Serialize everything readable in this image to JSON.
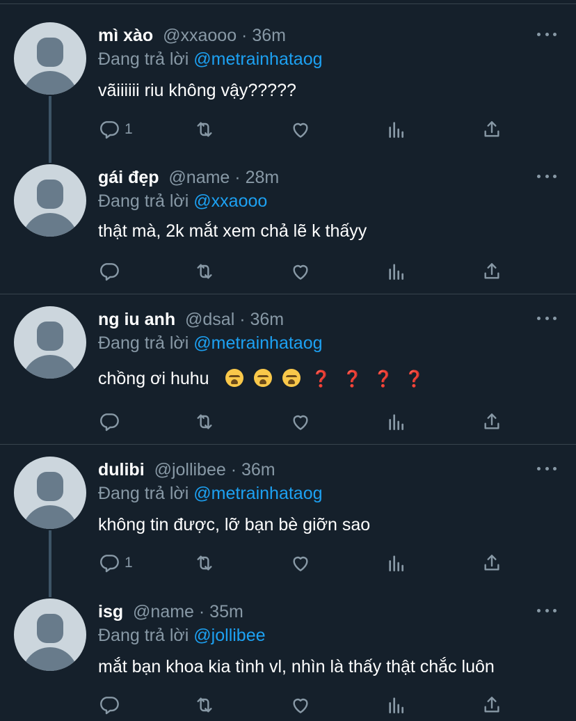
{
  "icons": {
    "reply": "reply-icon",
    "retweet": "retweet-icon",
    "like": "like-icon",
    "analytics": "analytics-icon",
    "share": "share-icon",
    "more": "more-icon"
  },
  "colors": {
    "background": "#15202b",
    "muted": "#8899a6",
    "mention": "#1da1f2",
    "divider": "#38444d"
  },
  "replying_label": "Đang trả lời",
  "tweets": [
    {
      "name": "mì xào",
      "handle": "@xxaooo",
      "time": "36m",
      "reply_to": "@metrainhataog",
      "text": "vãiiiiii riu không vậy?????",
      "reply_count": "1"
    },
    {
      "name": "gái đẹp",
      "handle": "@name",
      "time": "28m",
      "reply_to": "@xxaooo",
      "text": "thật mà, 2k mắt xem chả lẽ k thấyy",
      "reply_count": ""
    },
    {
      "name": "ng iu anh",
      "handle": "@dsal",
      "time": "36m",
      "reply_to": "@metrainhataog",
      "text": "chồng ơi huhu",
      "text_emojis": [
        "😭",
        "😭",
        "😭",
        "❓",
        "❓",
        "❓",
        "❓"
      ],
      "reply_count": ""
    },
    {
      "name": "dulibi",
      "handle": "@jollibee",
      "time": "36m",
      "reply_to": "@metrainhataog",
      "text": "không tin được, lỡ bạn bè giỡn sao",
      "reply_count": "1"
    },
    {
      "name": "isg",
      "handle": "@name",
      "time": "35m",
      "reply_to": "@jollibee",
      "text": "mắt bạn khoa kia tình vl, nhìn là thấy thật chắc luôn",
      "reply_count": ""
    }
  ]
}
